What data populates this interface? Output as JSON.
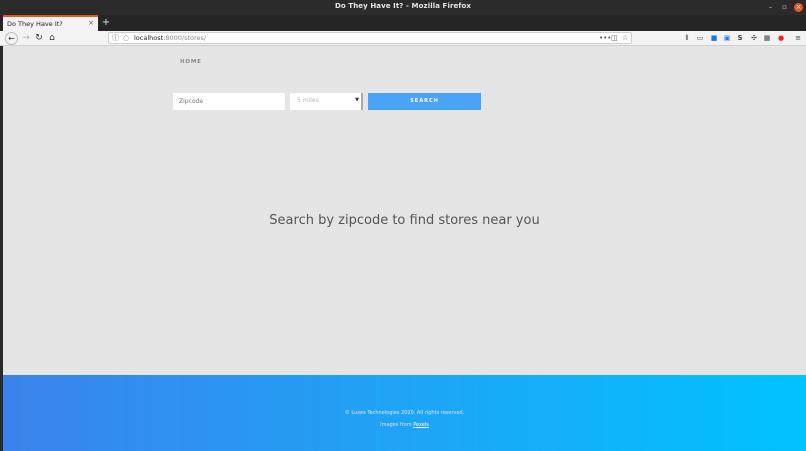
{
  "window": {
    "title": "Do They Have It? - Mozilla Firefox",
    "controls": {
      "minimize": "–",
      "maximize": "▫",
      "close": "×"
    }
  },
  "tabs": [
    {
      "label": "Do They Have It?",
      "close": "×",
      "active": true
    }
  ],
  "new_tab": "+",
  "nav": {
    "back": "←",
    "forward": "→",
    "reload": "↻",
    "home": "⌂",
    "url_host": "localhost",
    "url_rest": ":8000/stores/",
    "page_actions": [
      "•••",
      "◫",
      "☆"
    ]
  },
  "toolbar_icons": [
    "library-icon",
    "sidebar-icon",
    "extension-icon",
    "s-extension-icon",
    "grid-icon",
    "avatar-icon",
    "menu-icon"
  ],
  "page": {
    "nav_home": "HOME",
    "zip_placeholder": "Zipcode",
    "radius_selected": "5 miles",
    "search_label": "SEARCH",
    "prompt": "Search by zipcode to find stores near you"
  },
  "footer": {
    "copyright": "© Luxes Technologies 2020. All rights reserved.",
    "credit_prefix": "Images from",
    "credit_link": "Pexels"
  },
  "colors": {
    "accent_tab": "#e95420",
    "search_button": "#4aa3f7",
    "footer_gradient_start": "#3b82ec",
    "footer_gradient_end": "#00c3ff"
  }
}
